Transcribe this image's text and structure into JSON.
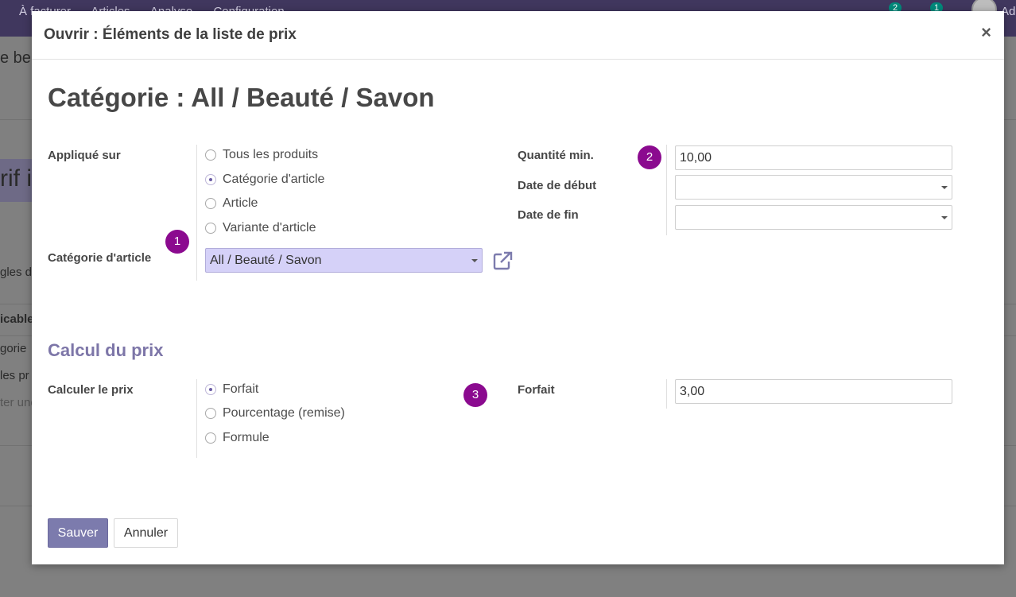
{
  "background": {
    "menu": [
      "À facturer",
      "Articles",
      "Analyse",
      "Configuration"
    ],
    "badges": [
      "2",
      "1"
    ],
    "user": "Ad",
    "side_texts": [
      "e be",
      "rif i",
      "gles d",
      "icable",
      "gorie",
      "les pr",
      "ter une"
    ]
  },
  "modal": {
    "title": "Ouvrir : Éléments de la liste de prix",
    "close": "×"
  },
  "form": {
    "record_title": "Catégorie : All / Beauté / Savon",
    "applied_on": {
      "label": "Appliqué sur",
      "options": [
        "Tous les produits",
        "Catégorie d'article",
        "Article",
        "Variante d'article"
      ],
      "selected": 1
    },
    "category": {
      "label": "Catégorie d'article",
      "value": "All / Beauté / Savon"
    },
    "min_qty": {
      "label": "Quantité min.",
      "value": "10,00"
    },
    "date_start": {
      "label": "Date de début",
      "value": ""
    },
    "date_end": {
      "label": "Date de fin",
      "value": ""
    },
    "section_price": "Calcul du prix",
    "compute_price": {
      "label": "Calculer le prix",
      "options": [
        "Forfait",
        "Pourcentage (remise)",
        "Formule"
      ],
      "selected": 0
    },
    "fixed_price": {
      "label": "Forfait",
      "value": "3,00"
    }
  },
  "markers": [
    "1",
    "2",
    "3"
  ],
  "footer": {
    "save": "Sauver",
    "cancel": "Annuler"
  },
  "colors": {
    "accent": "#7c7bad",
    "marker": "#8b0a8f",
    "selected_field": "#d5d1f8"
  }
}
